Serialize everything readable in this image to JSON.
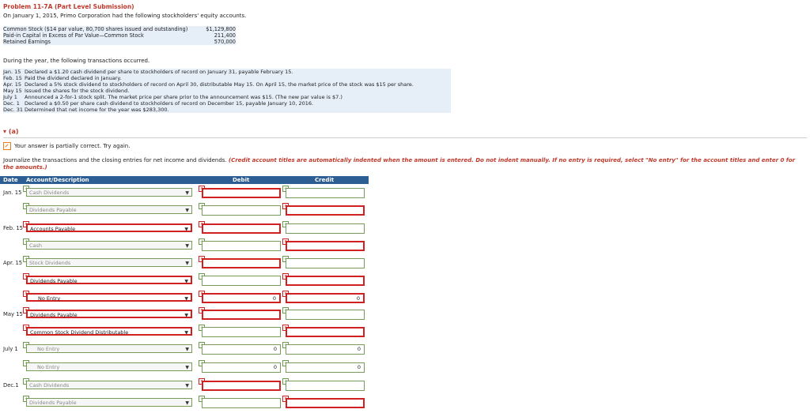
{
  "problem_title": "Problem 11-7A (Part Level Submission)",
  "intro": "On January 1, 2015, Primo Corporation had the following stockholders' equity accounts.",
  "equity": [
    {
      "label": "Common Stock ($14 par value, 80,700 shares issued and outstanding)",
      "amount": "$1,129,800"
    },
    {
      "label": "Paid-in Capital in Excess of Par Value—Common Stock",
      "amount": "211,400"
    },
    {
      "label": "Retained Earnings",
      "amount": "570,000"
    }
  ],
  "during": "During the year, the following transactions occurred.",
  "transactions": [
    {
      "date": "Jan. 15",
      "text": "Declared a $1.20 cash dividend per share to stockholders of record on January 31, payable February 15."
    },
    {
      "date": "Feb. 15",
      "text": "Paid the dividend declared in January."
    },
    {
      "date": "Apr. 15",
      "text": "Declared a 5% stock dividend to stockholders of record on April 30, distributable May 15. On April 15, the market price of the stock was $15 per share."
    },
    {
      "date": "May 15",
      "text": "Issued the shares for the stock dividend."
    },
    {
      "date": "July 1",
      "text": "Announced a 2-for-1 stock split. The market price per share prior to the announcement was $15. (The new par value is $7.)"
    },
    {
      "date": "Dec. 1",
      "text": "Declared a $0.50 per share cash dividend to stockholders of record on December 15, payable January 10, 2016."
    },
    {
      "date": "Dec. 31",
      "text": "Determined that net income for the year was $283,300."
    }
  ],
  "section": "(a)",
  "partial": "Your answer is partially correct.  Try again.",
  "instructions": "Journalize the transactions and the closing entries for net income and dividends.",
  "instructions_note": "(Credit account titles are automatically indented when the amount is entered. Do not indent manually. If no entry is required, select \"No entry\" for the account titles and enter 0 for the amounts.)",
  "journal_headers": {
    "date": "Date",
    "account": "Account/Description",
    "debit": "Debit",
    "credit": "Credit"
  },
  "rows": [
    {
      "date": "Jan. 15",
      "account": "Cash Dividends",
      "acct_ok": true,
      "debit": "",
      "debit_ok": false,
      "credit": "",
      "credit_ok": true
    },
    {
      "date": "",
      "account": "Dividends Payable",
      "acct_ok": true,
      "debit": "",
      "debit_ok": true,
      "credit": "",
      "credit_ok": false
    },
    {
      "date": "Feb. 15",
      "account": "Accounts Payable",
      "acct_ok": false,
      "debit": "",
      "debit_ok": false,
      "credit": "",
      "credit_ok": true
    },
    {
      "date": "",
      "account": "Cash",
      "acct_ok": true,
      "debit": "",
      "debit_ok": true,
      "credit": "",
      "credit_ok": false
    },
    {
      "date": "Apr. 15",
      "account": "Stock Dividends",
      "acct_ok": true,
      "debit": "",
      "debit_ok": false,
      "credit": "",
      "credit_ok": true
    },
    {
      "date": "",
      "account": "Dividends Payable",
      "acct_ok": false,
      "debit": "",
      "debit_ok": true,
      "credit": "",
      "credit_ok": false
    },
    {
      "date": "",
      "account": "No Entry",
      "acct_ok": false,
      "debit": "0",
      "debit_ok": false,
      "credit": "0",
      "credit_ok": false
    },
    {
      "date": "May 15",
      "account": "Dividends Payable",
      "acct_ok": false,
      "debit": "",
      "debit_ok": false,
      "credit": "",
      "credit_ok": true
    },
    {
      "date": "",
      "account": "Common Stock Dividend Distributable",
      "acct_ok": false,
      "debit": "",
      "debit_ok": true,
      "credit": "",
      "credit_ok": false
    },
    {
      "date": "July 1",
      "account": "No Entry",
      "acct_ok": true,
      "debit": "0",
      "debit_ok": true,
      "credit": "0",
      "credit_ok": true
    },
    {
      "date": "",
      "account": "No Entry",
      "acct_ok": true,
      "debit": "0",
      "debit_ok": true,
      "credit": "0",
      "credit_ok": true
    },
    {
      "date": "Dec.1",
      "account": "Cash Dividends",
      "acct_ok": true,
      "debit": "",
      "debit_ok": false,
      "credit": "",
      "credit_ok": true
    },
    {
      "date": "",
      "account": "Dividends Payable",
      "acct_ok": true,
      "debit": "",
      "debit_ok": true,
      "credit": "",
      "credit_ok": false
    }
  ],
  "colors": {
    "accent": "#2c5d93",
    "error": "#d02020",
    "ok": "#7a9a5b",
    "title": "#c0392b"
  }
}
